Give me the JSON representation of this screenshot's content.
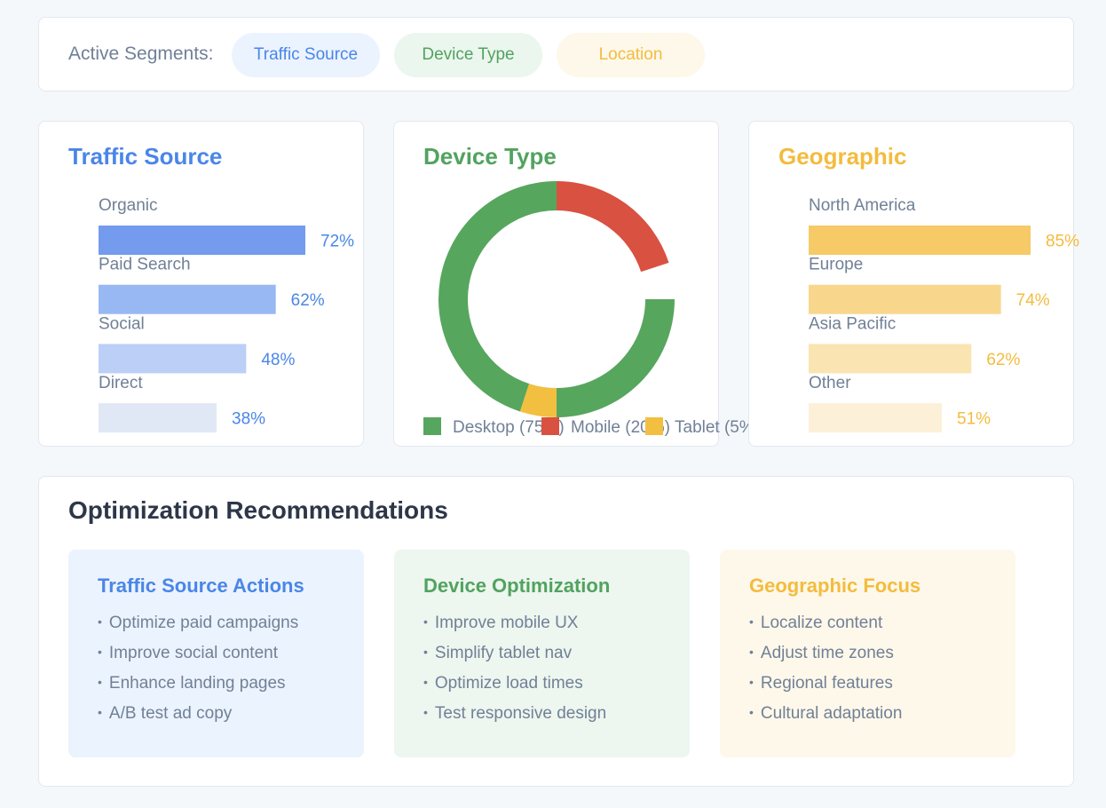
{
  "filters": {
    "label": "Active Segments:",
    "pills": [
      {
        "label": "Traffic Source",
        "color": "#4a86e8",
        "bg": "#ebf3fe"
      },
      {
        "label": "Device Type",
        "color": "#51a35f",
        "bg": "#ebf6ee"
      },
      {
        "label": "Location",
        "color": "#f3bc3e",
        "bg": "#fef8ea"
      }
    ]
  },
  "chart_data": [
    {
      "type": "bar",
      "title": "Traffic Source",
      "title_color": "#4a86e8",
      "orientation": "horizontal",
      "categories": [
        "Organic",
        "Paid Search",
        "Social",
        "Direct"
      ],
      "values": [
        72,
        62,
        48,
        38
      ],
      "labels": [
        "72%",
        "62%",
        "48%",
        "38%"
      ],
      "bar_colors": [
        "#759bef",
        "#98b8f3",
        "#bbcff7",
        "#e1e8f5"
      ],
      "label_color": "#4a86e8",
      "xlim": [
        0,
        100
      ]
    },
    {
      "type": "pie",
      "variant": "donut",
      "title": "Device Type",
      "title_color": "#51a35f",
      "slices": [
        {
          "label": "Desktop",
          "value": 75,
          "color": "#57a65e"
        },
        {
          "label": "Mobile",
          "value": 20,
          "color": "#d95140"
        },
        {
          "label": "Tablet",
          "value": 5,
          "color": "#f2bf40"
        }
      ],
      "legend": [
        "Desktop (75%)",
        "Mobile (20%)",
        "Tablet (5%)"
      ],
      "legend_position": "bottom"
    },
    {
      "type": "bar",
      "title": "Geographic",
      "title_color": "#f3bc3e",
      "orientation": "horizontal",
      "categories": [
        "North America",
        "Europe",
        "Asia Pacific",
        "Other"
      ],
      "values": [
        85,
        74,
        62,
        51
      ],
      "labels": [
        "85%",
        "74%",
        "62%",
        "51%"
      ],
      "bar_colors": [
        "#f5ca67",
        "#f8d78d",
        "#fae4b2",
        "#fcf0d8"
      ],
      "label_color": "#f3bc3e",
      "xlim": [
        0,
        100
      ]
    }
  ],
  "recommendations": {
    "heading": "Optimization Recommendations",
    "boxes": [
      {
        "title": "Traffic Source Actions",
        "color": "#4a86e8",
        "items": [
          "Optimize paid campaigns",
          "Improve social content",
          "Enhance landing pages",
          "A/B test ad copy"
        ]
      },
      {
        "title": "Device Optimization",
        "color": "#51a35f",
        "items": [
          "Improve mobile UX",
          "Simplify tablet nav",
          "Optimize load times",
          "Test responsive design"
        ]
      },
      {
        "title": "Geographic Focus",
        "color": "#f3bc3e",
        "items": [
          "Localize content",
          "Adjust time zones",
          "Regional features",
          "Cultural adaptation"
        ]
      }
    ]
  }
}
